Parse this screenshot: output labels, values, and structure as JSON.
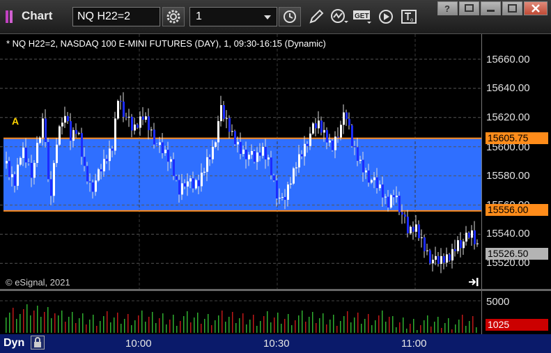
{
  "window": {
    "title": "Chart",
    "symbol": "NQ H22=2",
    "interval": "1"
  },
  "chart": {
    "header": "* NQ H22=2, NASDAQ 100 E-MINI FUTURES (DAY), 1, 09:30-16:15 (Dynamic)",
    "copyright": "© eSignal, 2021",
    "marker": "A",
    "price_labels": [
      "15660.00",
      "15640.00",
      "15620.00",
      "15600.00",
      "15580.00",
      "15560.00",
      "15540.00",
      "15520.00"
    ],
    "upper_level": "15605.75",
    "lower_level": "15556.00",
    "last_price": "15526.50",
    "volume_label": "5000",
    "last_volume": "1025",
    "time_labels": [
      "10:00",
      "10:30",
      "11:00"
    ],
    "mode": "Dyn"
  },
  "colors": {
    "up_candle": "#ffffff",
    "down_candle": "#1c2cff",
    "band_fill": "#2f6fff",
    "level_line": "#ff8c1a",
    "up_volume": "#2fae2f",
    "down_volume": "#c01818",
    "last_volume_tag": "#cc0000",
    "last_price_tag": "#b4b4b4",
    "time_axis_bg": "#0a1a6a"
  },
  "icons": [
    "gear-icon",
    "clock-icon",
    "pencil-icon",
    "studies-icon",
    "get-icon",
    "play-icon",
    "text-icon",
    "help-icon",
    "restore-icon",
    "maximize-icon",
    "close-icon",
    "scroll-end-icon",
    "lock-icon"
  ]
}
